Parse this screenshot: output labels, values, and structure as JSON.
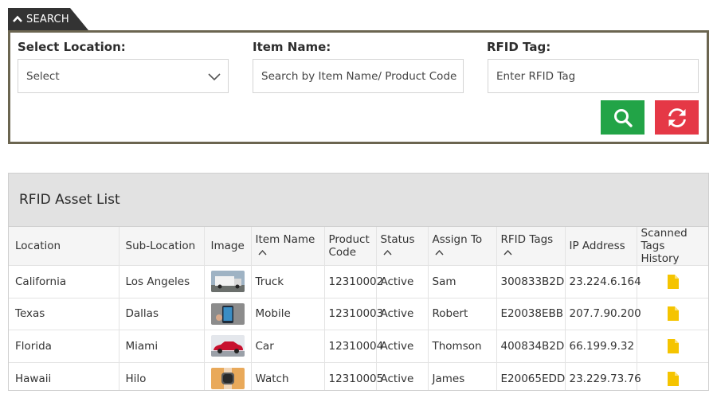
{
  "search": {
    "tab_label": "SEARCH",
    "location_label": "Select Location:",
    "location_value": "Select",
    "item_label": "Item Name:",
    "item_placeholder": "Search by Item Name/ Product Code",
    "rfid_label": "RFID Tag:",
    "rfid_placeholder": "Enter RFID Tag",
    "search_button_icon": "search-icon",
    "reset_button_icon": "refresh-icon",
    "search_button_color": "#22a447",
    "reset_button_color": "#e53846"
  },
  "asset_list": {
    "title": "RFID Asset List",
    "columns": [
      "Location",
      "Sub-Location",
      "Image",
      "Item Name",
      "Product Code",
      "Status",
      "Assign To",
      "RFID Tags",
      "IP Address",
      "Scanned Tags History"
    ],
    "rows": [
      {
        "location": "California",
        "sub_location": "Los Angeles",
        "image": "truck-image",
        "item": "Truck",
        "code": "12310002",
        "status": "Active",
        "assign": "Sam",
        "rfid": "300833B2D",
        "ip": "23.224.6.164",
        "history": "document-icon"
      },
      {
        "location": "Texas",
        "sub_location": "Dallas",
        "image": "mobile-image",
        "item": "Mobile",
        "code": "12310003",
        "status": "Active",
        "assign": "Robert",
        "rfid": "E20038EBB",
        "ip": "207.7.90.200",
        "history": "document-icon"
      },
      {
        "location": "Florida",
        "sub_location": "Miami",
        "image": "car-image",
        "item": "Car",
        "code": "12310004",
        "status": "Active",
        "assign": "Thomson",
        "rfid": "400834B2D",
        "ip": "66.199.9.32",
        "history": "document-icon"
      },
      {
        "location": "Hawaii",
        "sub_location": "Hilo",
        "image": "watch-image",
        "item": "Watch",
        "code": "12310005",
        "status": "Active",
        "assign": "James",
        "rfid": "E20065EDD",
        "ip": "23.229.73.76",
        "history": "document-icon"
      }
    ]
  }
}
